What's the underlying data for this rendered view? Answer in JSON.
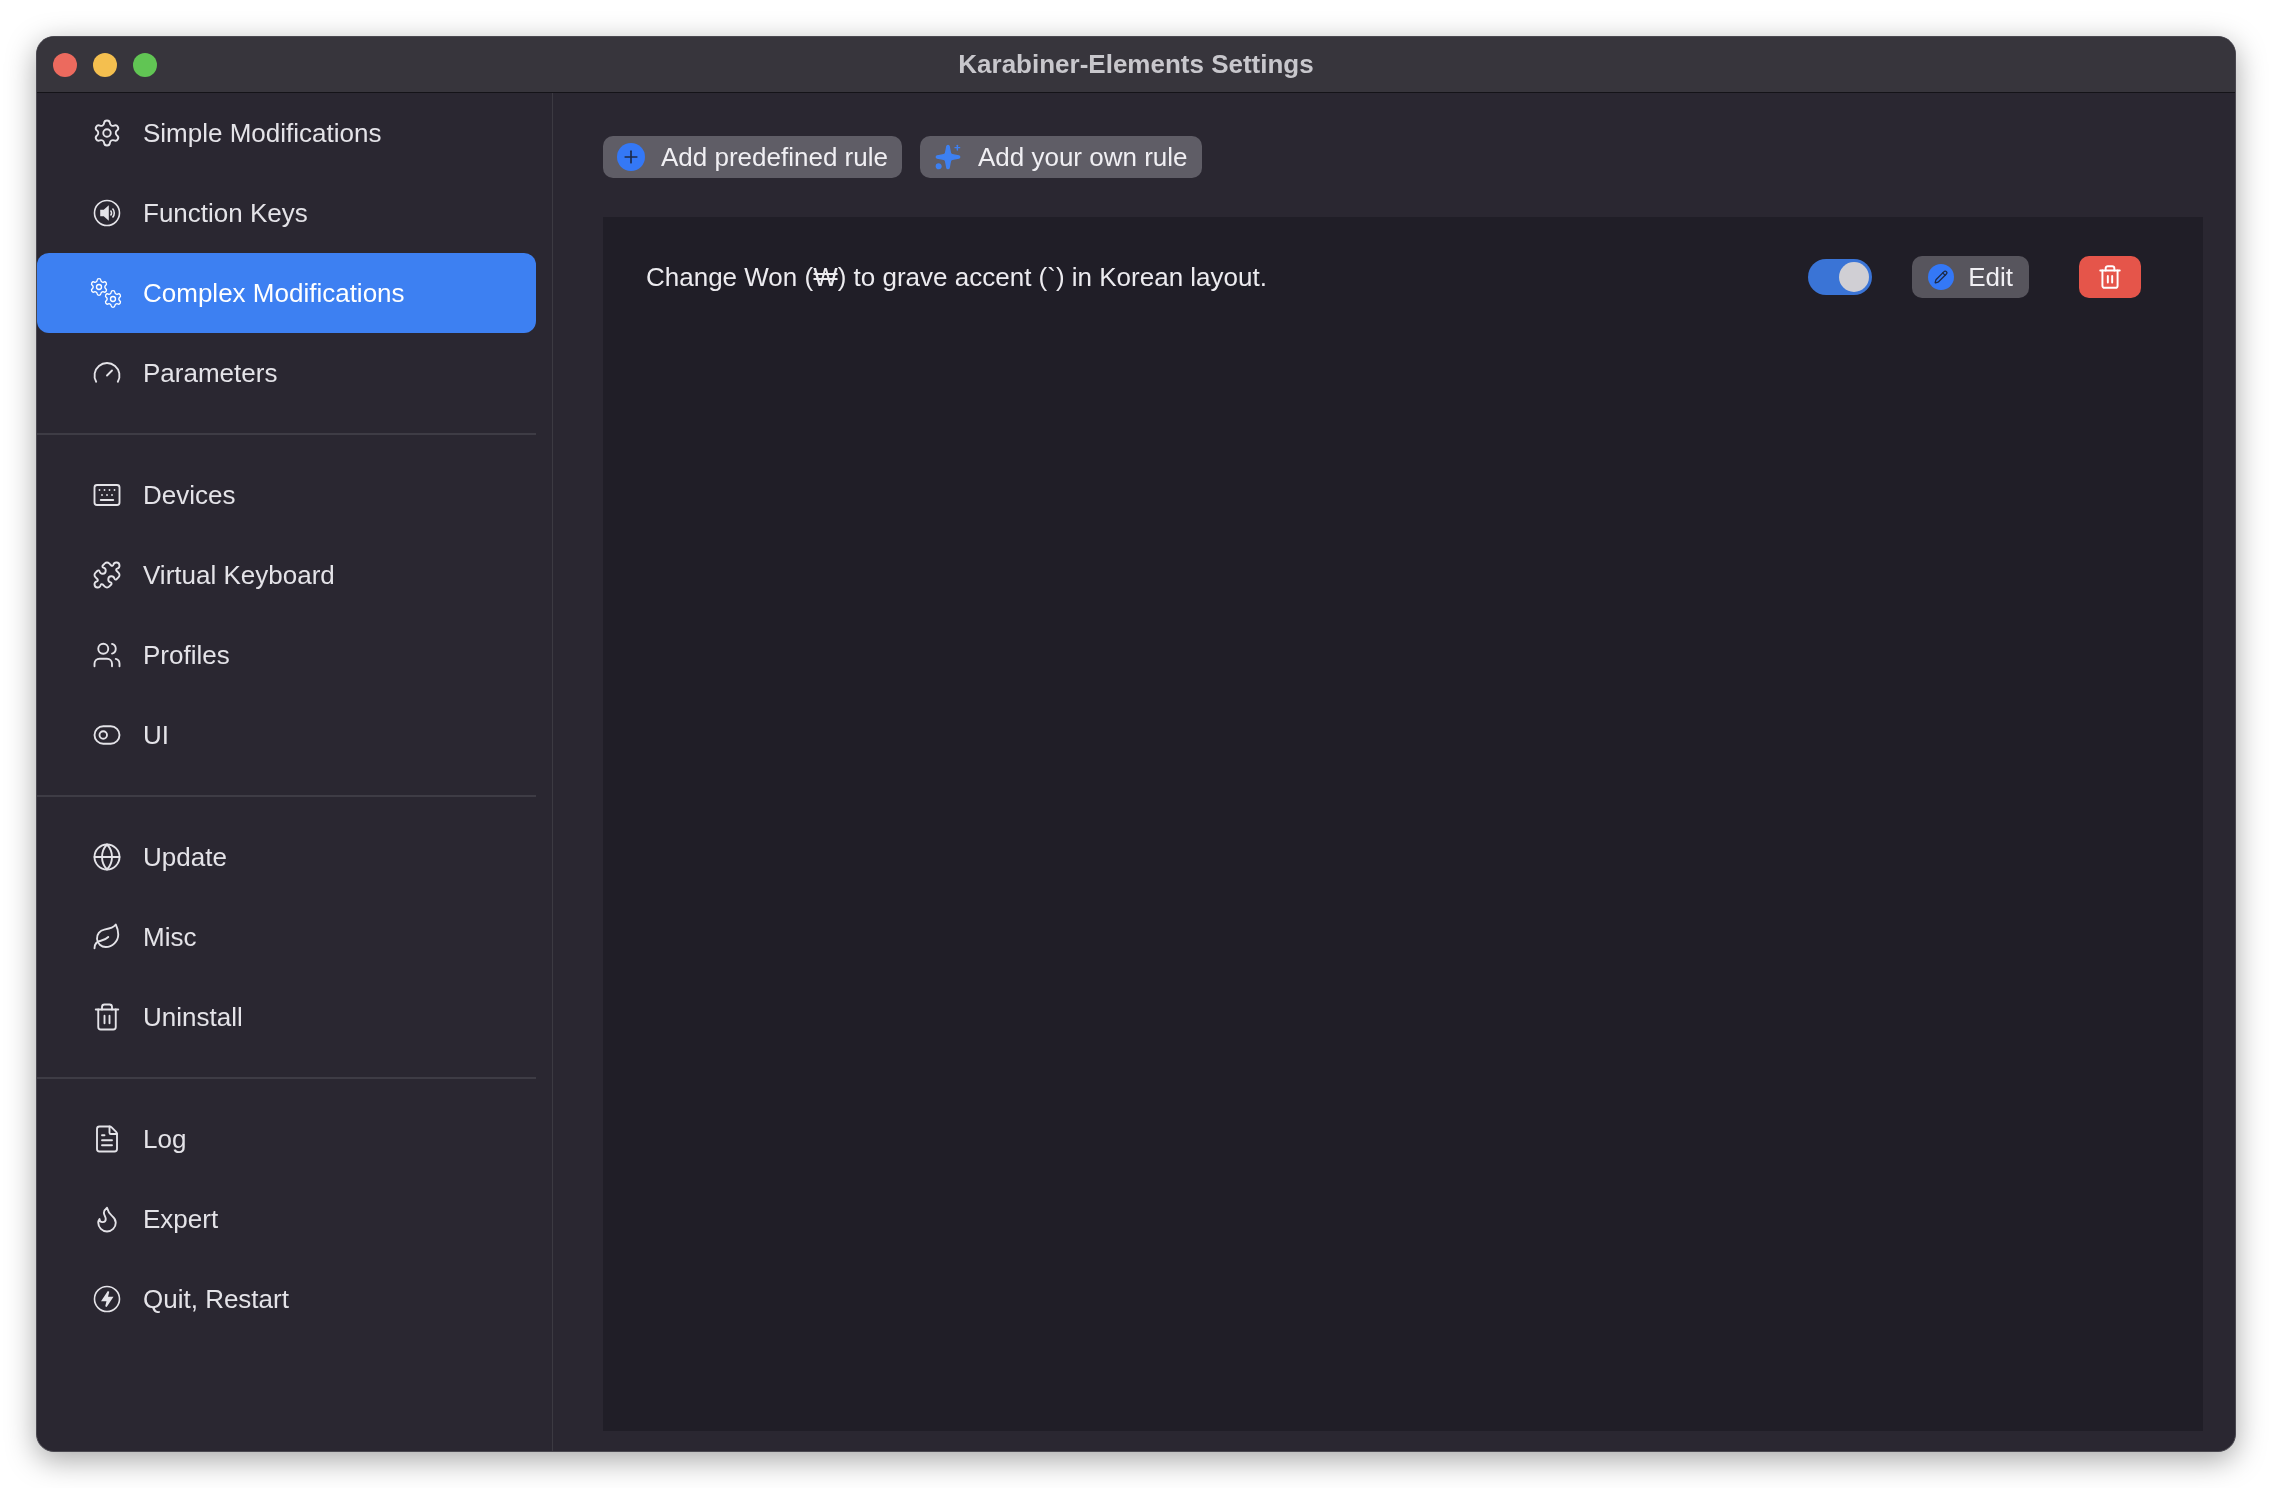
{
  "window": {
    "title": "Karabiner-Elements Settings"
  },
  "sidebar": {
    "sections": [
      {
        "items": [
          {
            "label": "Simple Modifications",
            "selected": false
          },
          {
            "label": "Function Keys",
            "selected": false
          },
          {
            "label": "Complex Modifications",
            "selected": true
          },
          {
            "label": "Parameters",
            "selected": false
          }
        ]
      },
      {
        "items": [
          {
            "label": "Devices",
            "selected": false
          },
          {
            "label": "Virtual Keyboard",
            "selected": false
          },
          {
            "label": "Profiles",
            "selected": false
          },
          {
            "label": "UI",
            "selected": false
          }
        ]
      },
      {
        "items": [
          {
            "label": "Update",
            "selected": false
          },
          {
            "label": "Misc",
            "selected": false
          },
          {
            "label": "Uninstall",
            "selected": false
          }
        ]
      },
      {
        "items": [
          {
            "label": "Log",
            "selected": false
          },
          {
            "label": "Expert",
            "selected": false
          },
          {
            "label": "Quit, Restart",
            "selected": false
          }
        ]
      }
    ]
  },
  "toolbar": {
    "buttons": [
      "Add predefined rule",
      "Add your own rule"
    ]
  },
  "rules": [
    {
      "description": "Change Won (₩) to grave accent (`) in Korean layout.",
      "enabled": true,
      "edit_label": "Edit"
    }
  ]
}
